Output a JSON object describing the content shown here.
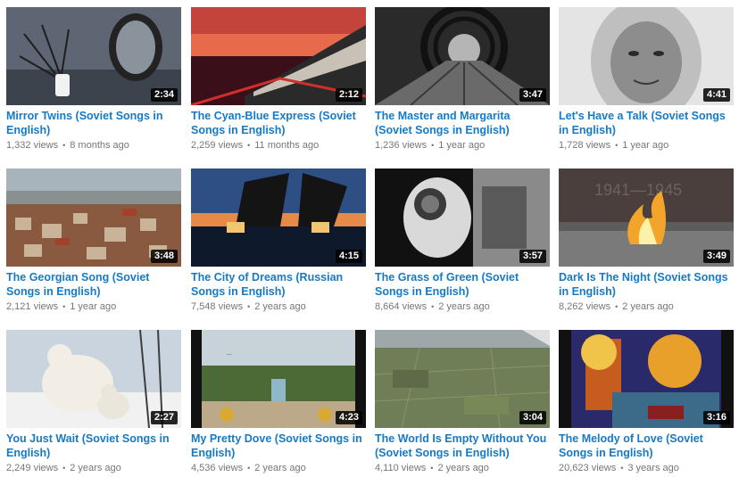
{
  "videos": [
    {
      "title": "Mirror Twins (Soviet Songs in English)",
      "duration": "2:34",
      "views": "1,332 views",
      "age": "8 months ago",
      "thumb": "mirror"
    },
    {
      "title": "The Cyan-Blue Express (Soviet Songs in English)",
      "duration": "2:12",
      "views": "2,259 views",
      "age": "11 months ago",
      "thumb": "train"
    },
    {
      "title": "The Master and Margarita (Soviet Songs in English)",
      "duration": "3:47",
      "views": "1,236 views",
      "age": "1 year ago",
      "thumb": "tunnel"
    },
    {
      "title": "Let's Have a Talk (Soviet Songs in English)",
      "duration": "4:41",
      "views": "1,728 views",
      "age": "1 year ago",
      "thumb": "oldwoman"
    },
    {
      "title": "The Georgian Song (Soviet Songs in English)",
      "duration": "3:48",
      "views": "2,121 views",
      "age": "1 year ago",
      "thumb": "town"
    },
    {
      "title": "The City of Dreams (Russian Songs in English)",
      "duration": "4:15",
      "views": "7,548 views",
      "age": "2 years ago",
      "thumb": "bridge"
    },
    {
      "title": "The Grass of Green (Soviet Songs in English)",
      "duration": "3:57",
      "views": "8,664 views",
      "age": "2 years ago",
      "thumb": "astronaut"
    },
    {
      "title": "Dark Is The Night (Soviet Songs in English)",
      "duration": "3:49",
      "views": "8,262 views",
      "age": "2 years ago",
      "thumb": "flame"
    },
    {
      "title": "You Just Wait (Soviet Songs in English)",
      "duration": "2:27",
      "views": "2,249 views",
      "age": "2 years ago",
      "thumb": "bears"
    },
    {
      "title": "My Pretty Dove (Soviet Songs in English)",
      "duration": "4:23",
      "views": "4,536 views",
      "age": "2 years ago",
      "thumb": "fountain"
    },
    {
      "title": "The World Is Empty Without You (Soviet Songs in English)",
      "duration": "3:04",
      "views": "4,110 views",
      "age": "2 years ago",
      "thumb": "aerial"
    },
    {
      "title": "The Melody of Love (Soviet Songs in English)",
      "duration": "3:16",
      "views": "20,623 views",
      "age": "3 years ago",
      "thumb": "painting"
    }
  ]
}
